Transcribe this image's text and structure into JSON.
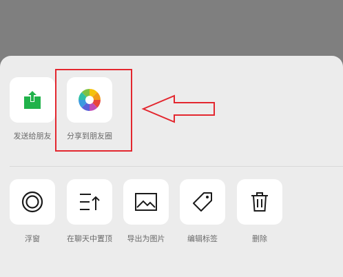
{
  "share_row": [
    {
      "label": "发送给朋友",
      "icon": "share-upload-icon"
    },
    {
      "label": "分享到朋友圈",
      "icon": "moments-aperture-icon"
    }
  ],
  "action_row": [
    {
      "label": "浮窗",
      "icon": "float-window-icon"
    },
    {
      "label": "在聊天中置顶",
      "icon": "pin-top-icon"
    },
    {
      "label": "导出为图片",
      "icon": "image-icon"
    },
    {
      "label": "编辑标签",
      "icon": "tag-icon"
    },
    {
      "label": "删除",
      "icon": "trash-icon"
    }
  ],
  "colors": {
    "accent_green": "#20b24a",
    "highlight_red": "#e3262e"
  }
}
